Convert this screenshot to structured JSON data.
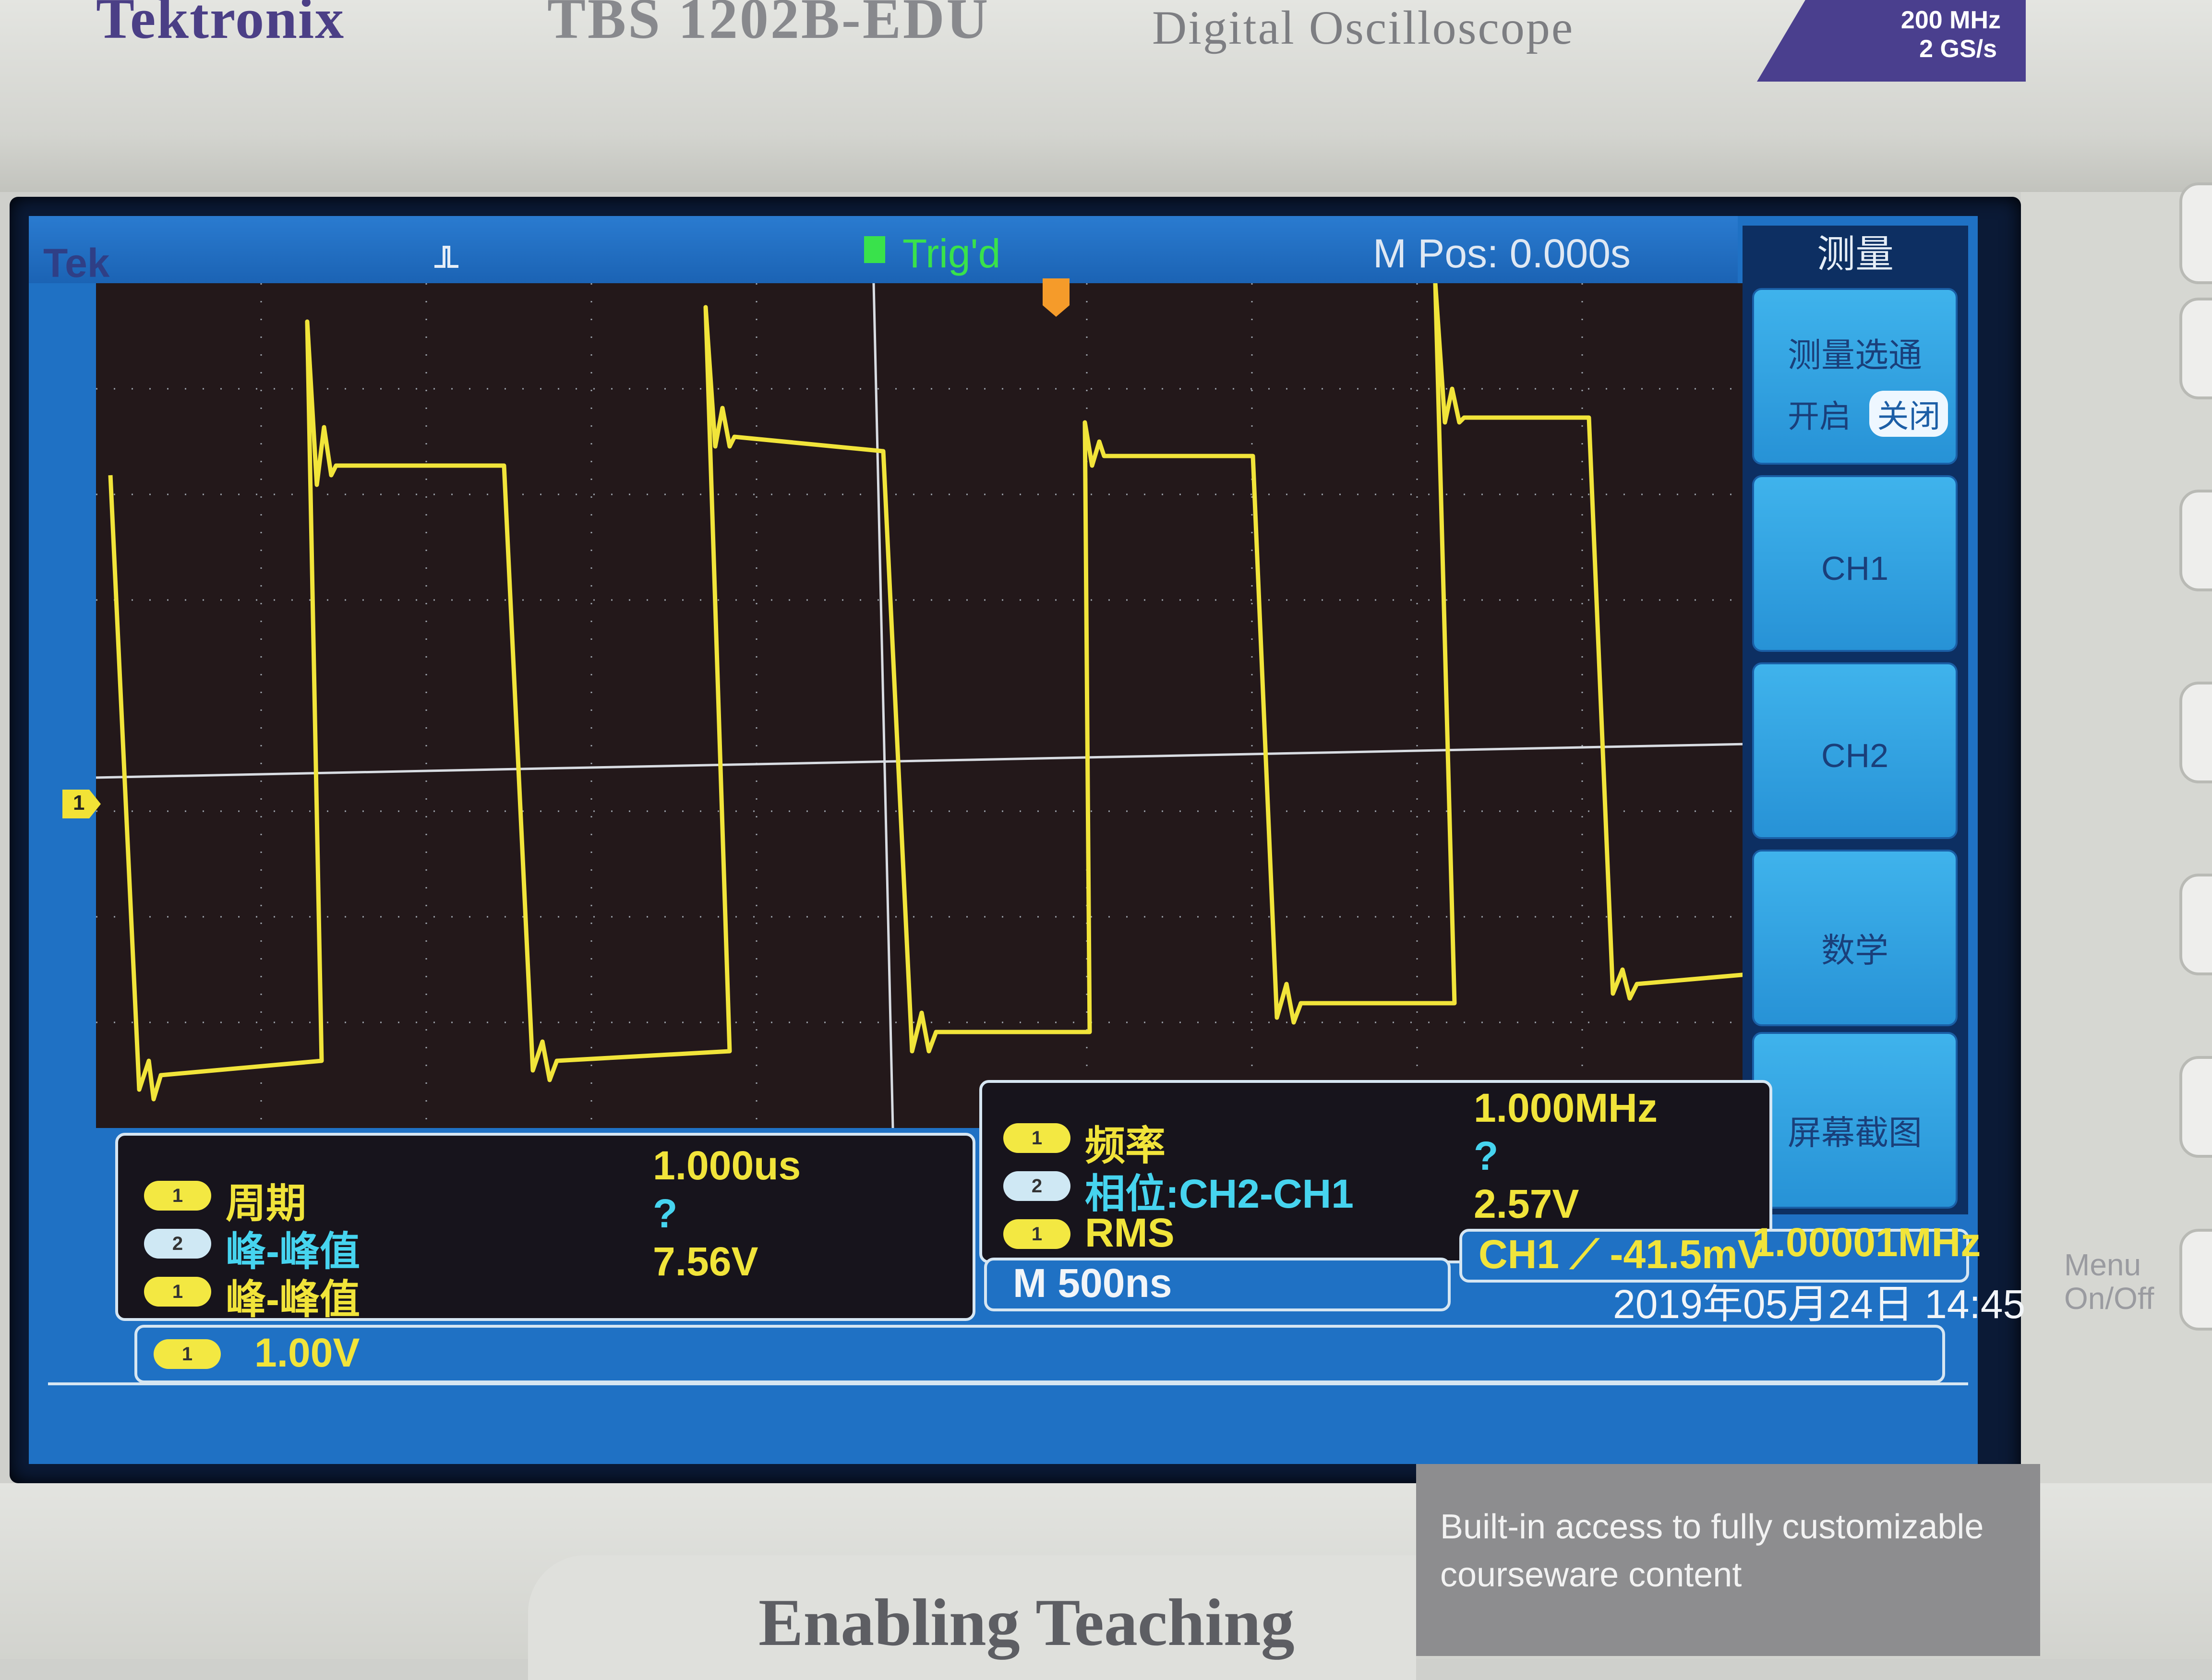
{
  "instrument": {
    "brand": "Tektronix",
    "model": "TBS 1202B-EDU",
    "description": "Digital Oscilloscope",
    "bandwidth": "200 MHz",
    "sample_rate": "2 GS/s"
  },
  "status_bar": {
    "brand_short": "Tek",
    "trigger_status": "Trig'd",
    "horizontal_position": "M Pos: 0.000s"
  },
  "side_menu": {
    "title": "测量",
    "options_label": "测量选通",
    "on_label": "开启",
    "off_label": "关闭",
    "ch1": "CH1",
    "ch2": "CH2",
    "math": "数学",
    "screenshot": "屏幕截图"
  },
  "measurements_left": [
    {
      "channel": "1",
      "name": "周期",
      "value": "1.000us"
    },
    {
      "channel": "2",
      "name": "峰-峰值",
      "value": "?"
    },
    {
      "channel": "1",
      "name": "峰-峰值",
      "value": "7.56V"
    }
  ],
  "measurements_right": [
    {
      "channel": "1",
      "name": "频率",
      "value": "1.000MHz"
    },
    {
      "channel": "2",
      "name": "相位:CH2-CH1",
      "value": "?"
    },
    {
      "channel": "1",
      "name": "RMS",
      "value": "2.57V"
    }
  ],
  "readouts": {
    "timebase": "M 500ns",
    "trigger": "CH1 ⟋ -41.5mV",
    "trigger_freq": "1.00001MHz",
    "datetime": "2019年05月24日 14:45",
    "ch1_scale_channel": "1",
    "ch1_scale": "1.00V",
    "ch1_marker": "1"
  },
  "front_panel": {
    "slogan": "Enabling Teaching",
    "courseware_line1": "Built-in access to fully customizable",
    "courseware_line2": "courseware content",
    "menu_onoff": "Menu On/Off"
  },
  "colors": {
    "ch1": "#f1e43a",
    "ch2": "#46d4ef",
    "trig": "#39e24b",
    "screen": "#1f71c4"
  }
}
